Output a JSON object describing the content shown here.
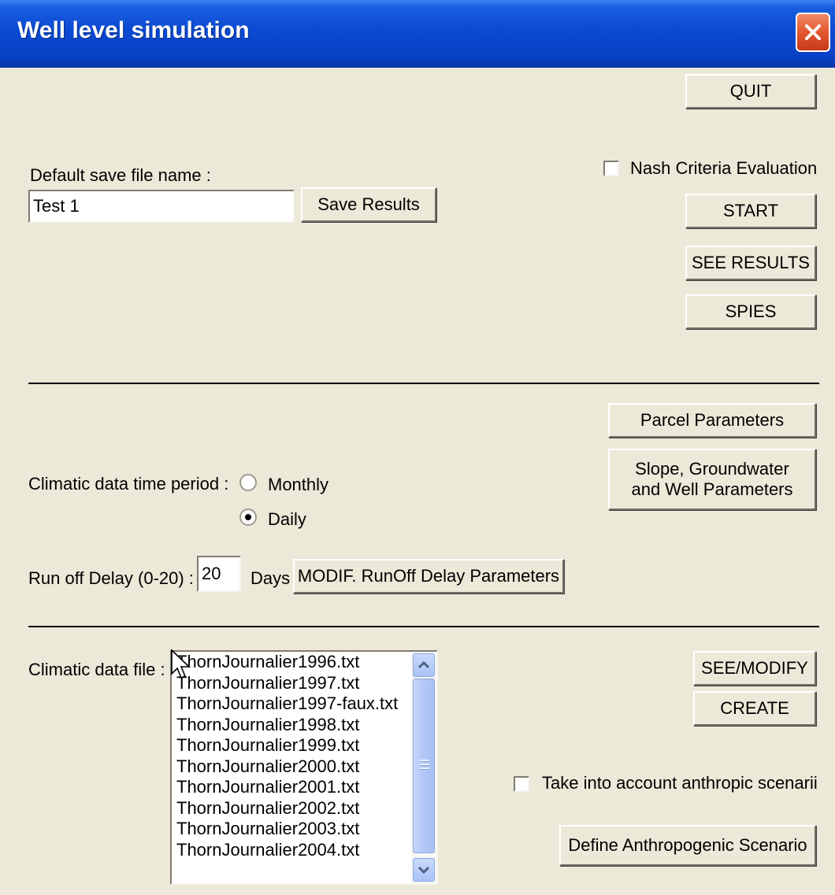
{
  "window": {
    "title": "Well level simulation"
  },
  "buttons": {
    "quit": "QUIT",
    "start": "START",
    "see_results": "SEE RESULTS",
    "spies": "SPIES",
    "save_results": "Save Results",
    "parcel_parameters": "Parcel Parameters",
    "slope_params": "Slope, Groundwater  and Well Parameters",
    "modif_runoff": "MODIF. RunOff Delay Parameters",
    "see_modify": "SEE/MODIFY",
    "create": "CREATE",
    "define_scenario": "Define Anthropogenic Scenario"
  },
  "save_file": {
    "label": "Default save file name :",
    "value": "Test 1"
  },
  "nash": {
    "label": "Nash Criteria Evaluation",
    "checked": false
  },
  "climatic_period": {
    "label": "Climatic data time period :",
    "options": [
      "Monthly",
      "Daily"
    ],
    "selected": "Daily"
  },
  "runoff": {
    "label": "Run off Delay (0-20) :",
    "value": "20",
    "unit": "Days"
  },
  "climatic_file": {
    "label": "Climatic data file :",
    "items": [
      "ThornJournalier1996.txt",
      "ThornJournalier1997.txt",
      "ThornJournalier1997-faux.txt",
      "ThornJournalier1998.txt",
      "ThornJournalier1999.txt",
      "ThornJournalier2000.txt",
      "ThornJournalier2001.txt",
      "ThornJournalier2002.txt",
      "ThornJournalier2003.txt",
      "ThornJournalier2004.txt"
    ]
  },
  "anthropic": {
    "label": "Take into account anthropic scenarii",
    "checked": false
  },
  "icons": [
    "close-icon",
    "scroll-up-icon",
    "scroll-down-icon",
    "mouse-cursor-icon"
  ]
}
